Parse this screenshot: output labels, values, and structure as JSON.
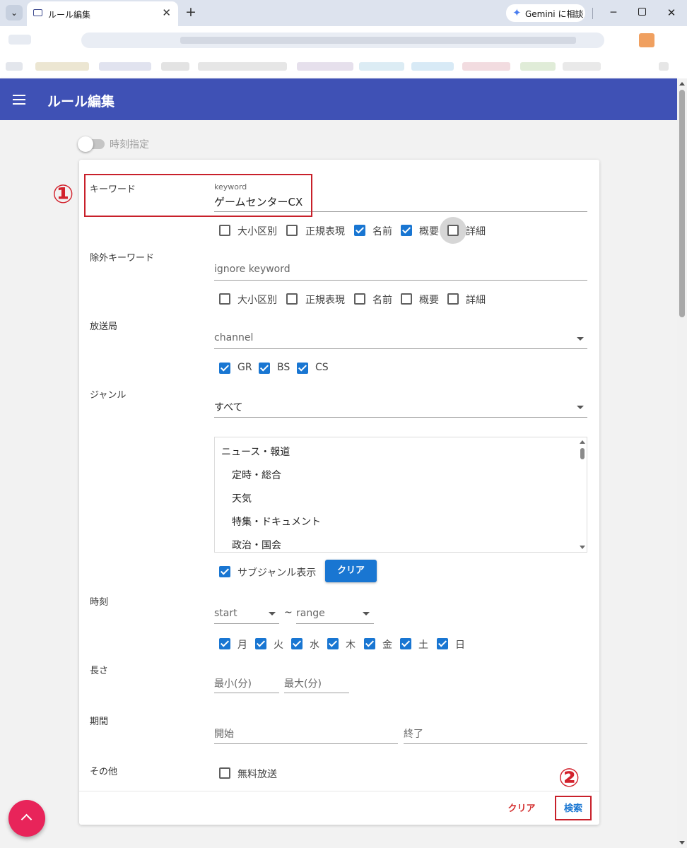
{
  "browser": {
    "tab_title": "ルール編集",
    "tab_close": "✕",
    "new_tab": "+",
    "gemini_button": "Gemini に相談",
    "minimize": "─",
    "close": "✕"
  },
  "app": {
    "title": "ルール編集",
    "accent_color": "#3f51b5",
    "time_toggle_label": "時刻指定",
    "time_toggle_on": false
  },
  "form": {
    "keyword": {
      "label": "キーワード",
      "float_label": "keyword",
      "value": "ゲームセンターCX",
      "options": [
        {
          "label": "大小区別",
          "checked": false
        },
        {
          "label": "正規表現",
          "checked": false
        },
        {
          "label": "名前",
          "checked": true
        },
        {
          "label": "概要",
          "checked": true
        },
        {
          "label": "詳細",
          "checked": false
        }
      ]
    },
    "exclude": {
      "label": "除外キーワード",
      "placeholder": "ignore keyword",
      "options": [
        {
          "label": "大小区別",
          "checked": false
        },
        {
          "label": "正規表現",
          "checked": false
        },
        {
          "label": "名前",
          "checked": false
        },
        {
          "label": "概要",
          "checked": false
        },
        {
          "label": "詳細",
          "checked": false
        }
      ]
    },
    "station": {
      "label": "放送局",
      "placeholder": "channel",
      "types": [
        {
          "label": "GR",
          "checked": true
        },
        {
          "label": "BS",
          "checked": true
        },
        {
          "label": "CS",
          "checked": true
        }
      ]
    },
    "genre": {
      "label": "ジャンル",
      "value": "すべて",
      "list": [
        "ニュース・報道",
        "定時・総合",
        "天気",
        "特集・ドキュメント",
        "政治・国会"
      ],
      "subgenre_label": "サブジャンル表示",
      "subgenre_checked": true,
      "clear_button": "クリア"
    },
    "time": {
      "label": "時刻",
      "start_placeholder": "start",
      "tilde": "~",
      "range_placeholder": "range",
      "days": [
        {
          "label": "月",
          "checked": true
        },
        {
          "label": "火",
          "checked": true
        },
        {
          "label": "水",
          "checked": true
        },
        {
          "label": "木",
          "checked": true
        },
        {
          "label": "金",
          "checked": true
        },
        {
          "label": "土",
          "checked": true
        },
        {
          "label": "日",
          "checked": true
        }
      ]
    },
    "length": {
      "label": "長さ",
      "min_placeholder": "最小(分)",
      "max_placeholder": "最大(分)"
    },
    "period": {
      "label": "期間",
      "start_placeholder": "開始",
      "end_placeholder": "終了"
    },
    "other": {
      "label": "その他",
      "free_label": "無料放送",
      "free_checked": false
    }
  },
  "footer": {
    "clear": "クリア",
    "search": "検索",
    "clear_color": "#d32f2f",
    "search_color": "#1976d2"
  },
  "annotations": {
    "step1": "①",
    "step2": "②",
    "color": "#c8202a"
  }
}
